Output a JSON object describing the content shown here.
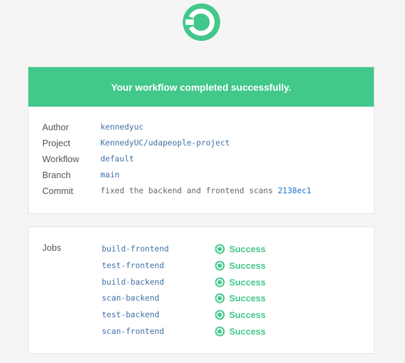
{
  "brand_color": "#42c88a",
  "logo": {
    "icon": "checkmark-circle-logo-icon"
  },
  "banner": {
    "title": "Your workflow completed successfully."
  },
  "details": [
    {
      "label": "Author",
      "value": "kennedyuc"
    },
    {
      "label": "Project",
      "value": "KennedyUC/udapeople-project"
    },
    {
      "label": "Workflow",
      "value": "default"
    },
    {
      "label": "Branch",
      "value": "main"
    },
    {
      "label": "Commit",
      "value": "fixed the backend and frontend scans",
      "hash": "2138ec1"
    }
  ],
  "jobs": {
    "label": "Jobs",
    "items": [
      {
        "name": "build-frontend",
        "status": "Success"
      },
      {
        "name": "test-frontend",
        "status": "Success"
      },
      {
        "name": "build-backend",
        "status": "Success"
      },
      {
        "name": "scan-backend",
        "status": "Success"
      },
      {
        "name": "test-backend",
        "status": "Success"
      },
      {
        "name": "scan-frontend",
        "status": "Success"
      }
    ]
  }
}
